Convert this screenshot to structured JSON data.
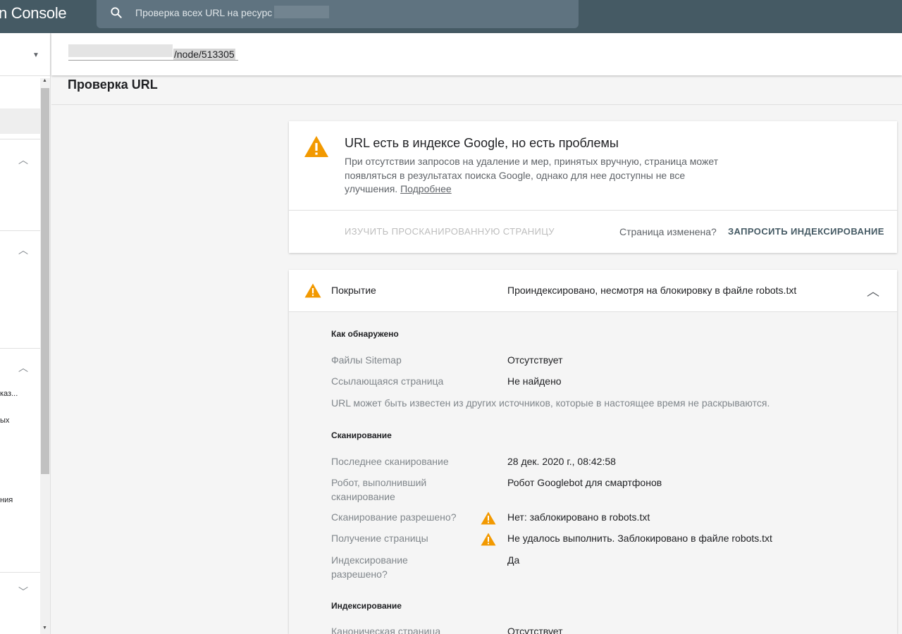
{
  "header": {
    "brand": "n Console",
    "search_placeholder": "Проверка всех URL на ресурс"
  },
  "urlbar": {
    "url_suffix": "/node/513305"
  },
  "page": {
    "title": "Проверка URL"
  },
  "sidebar": {
    "truncated_items": [
      "каз...",
      "ых",
      "ния"
    ]
  },
  "status": {
    "heading": "URL есть в индексе Google, но есть проблемы",
    "description": "При отсутствии запросов на удаление и мер, принятых вручную, страница может появляться в результатах поиска Google, однако для нее доступны не все улучшения.",
    "more_link": "Подробнее",
    "inspect_button": "ИЗУЧИТЬ ПРОСКАНИРОВАННУЮ СТРАНИЦУ",
    "changed_text": "Страница изменена?",
    "request_button": "ЗАПРОСИТЬ ИНДЕКСИРОВАНИЕ"
  },
  "coverage": {
    "label": "Покрытие",
    "status": "Проиндексировано, несмотря на блокировку в файле robots.txt",
    "discovery": {
      "title": "Как обнаружено",
      "sitemaps_label": "Файлы Sitemap",
      "sitemaps_value": "Отсутствует",
      "referring_label": "Ссылающаяся страница",
      "referring_value": "Не найдено",
      "note": "URL может быть известен из других источников, которые в настоящее время не раскрываются."
    },
    "crawl": {
      "title": "Сканирование",
      "last_crawl_label": "Последнее сканирование",
      "last_crawl_value": "28 дек. 2020 г., 08:42:58",
      "crawled_as_label": "Робот, выполнивший сканирование",
      "crawled_as_value": "Робот Googlebot для смартфонов",
      "crawl_allowed_label": "Сканирование разрешено?",
      "crawl_allowed_value": "Нет: заблокировано в robots.txt",
      "page_fetch_label": "Получение страницы",
      "page_fetch_value": "Не удалось выполнить. Заблокировано в файле robots.txt",
      "indexing_allowed_label": "Индексирование разрешено?",
      "indexing_allowed_value": "Да"
    },
    "indexing": {
      "title": "Индексирование",
      "canonical_label": "Каноническая страница",
      "canonical_value": "Отсутствует"
    }
  },
  "colors": {
    "header_bg": "#455a64",
    "warning": "#f29900",
    "accent": "#455a64"
  }
}
